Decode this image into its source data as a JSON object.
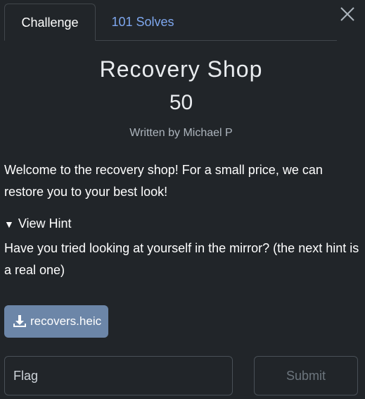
{
  "tabs": [
    {
      "label": "Challenge",
      "active": true
    },
    {
      "label": "101 Solves",
      "active": false
    }
  ],
  "challenge": {
    "title": "Recovery Shop",
    "points": "50",
    "author": "Written by Michael P",
    "description": "Welcome to the recovery shop! For a small price, we can restore you to your best look!",
    "hint_toggle_label": "View Hint",
    "hint_text": "Have you tried looking at yourself in the mirror? (the next hint is a real one)",
    "file_name": "recovers.heic"
  },
  "form": {
    "flag_placeholder": "Flag",
    "flag_value": "",
    "submit_label": "Submit"
  },
  "icons": {
    "close": "close-icon",
    "hint": "triangle-down-icon",
    "download": "download-icon"
  },
  "colors": {
    "background": "#212529",
    "accent_link": "#7ea7ee",
    "file_button": "#6c86a8"
  }
}
